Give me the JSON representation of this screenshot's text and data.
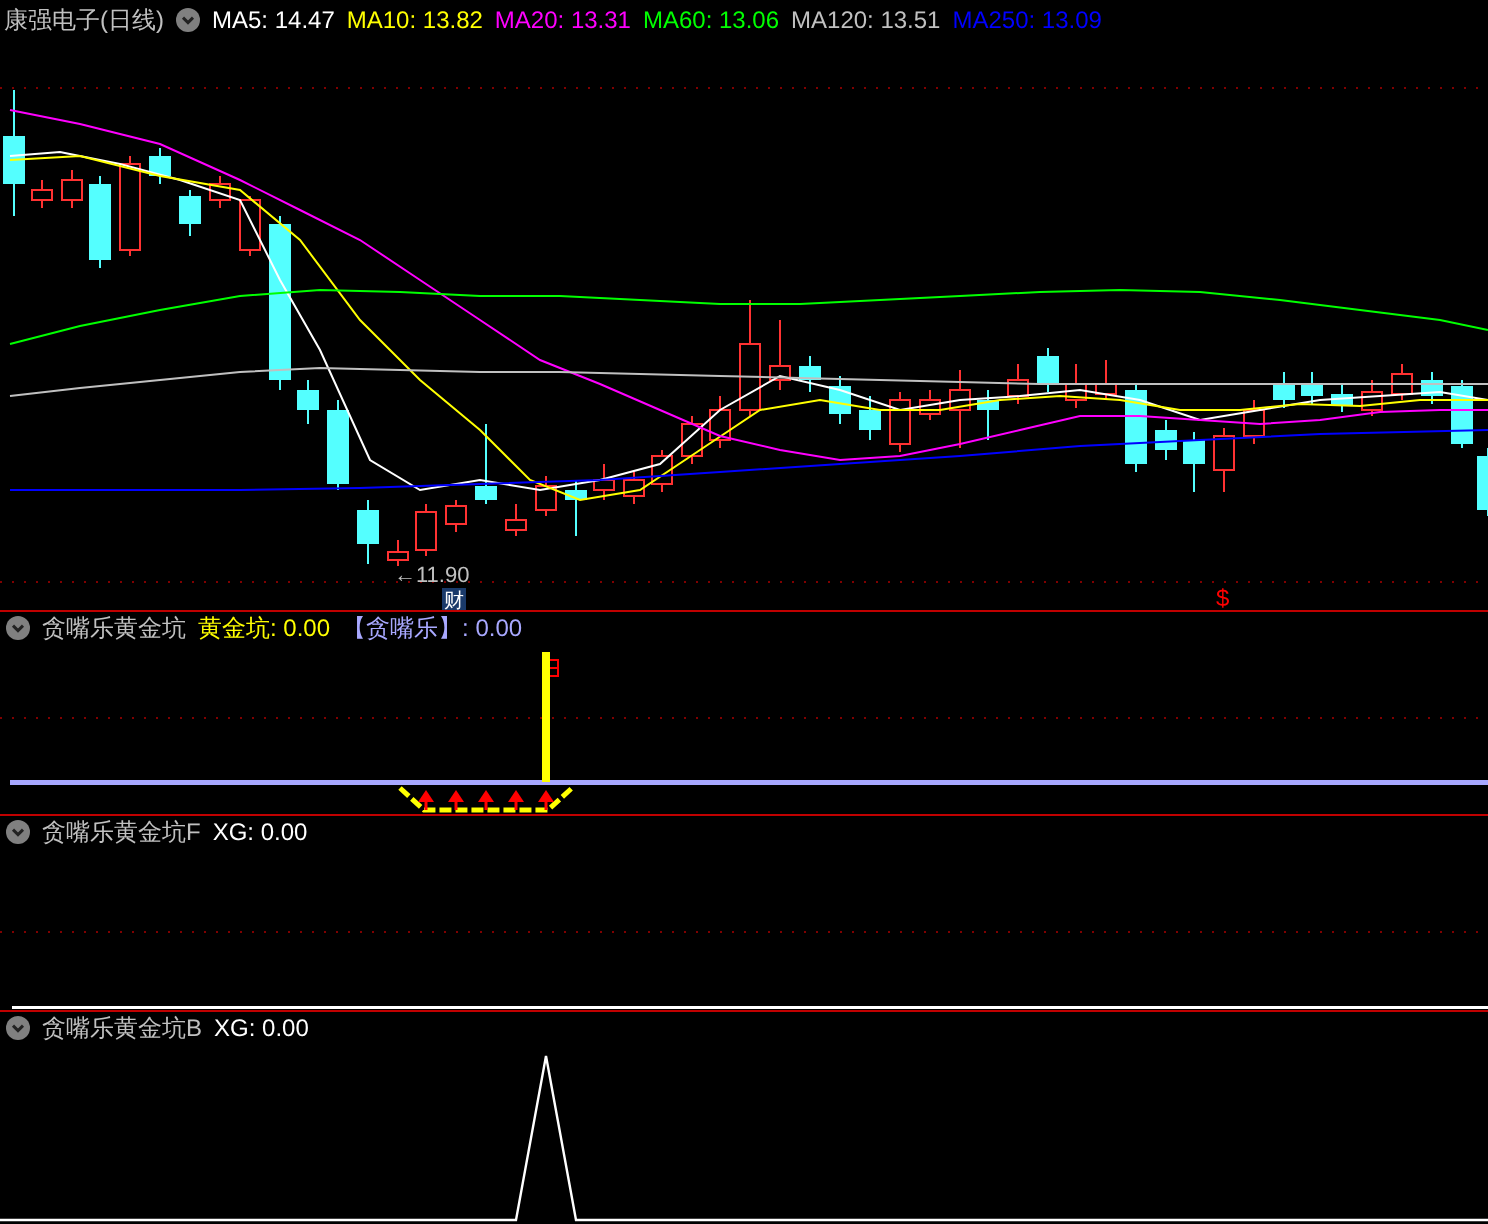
{
  "header": {
    "title": "康强电子(日线)",
    "indicators": [
      {
        "label": "MA5: 14.47",
        "color": "#ffffff"
      },
      {
        "label": "MA10: 13.82",
        "color": "#ffff00"
      },
      {
        "label": "MA20: 13.31",
        "color": "#ff00ff"
      },
      {
        "label": "MA60: 13.06",
        "color": "#00ff00"
      },
      {
        "label": "MA120: 13.51",
        "color": "#c0c0c0"
      },
      {
        "label": "MA250: 13.09",
        "color": "#0000ff"
      }
    ]
  },
  "chart": {
    "low_label": "←11.90",
    "finance_badge": "财",
    "dollar_mark": "$"
  },
  "panels": [
    {
      "name": "贪嘴乐黄金坑",
      "kind": "pit",
      "values": [
        {
          "label": "黄金坑: 0.00",
          "color": "#ffff00"
        },
        {
          "label": "【贪嘴乐】: 0.00",
          "color": "#a8a8ff"
        }
      ]
    },
    {
      "name": "贪嘴乐黄金坑F",
      "kind": "flat",
      "values": [
        {
          "label": "XG: 0.00",
          "color": "#ffffff"
        }
      ]
    },
    {
      "name": "贪嘴乐黄金坑B",
      "kind": "spike",
      "values": [
        {
          "label": "XG: 0.00",
          "color": "#ffffff"
        }
      ]
    }
  ]
}
